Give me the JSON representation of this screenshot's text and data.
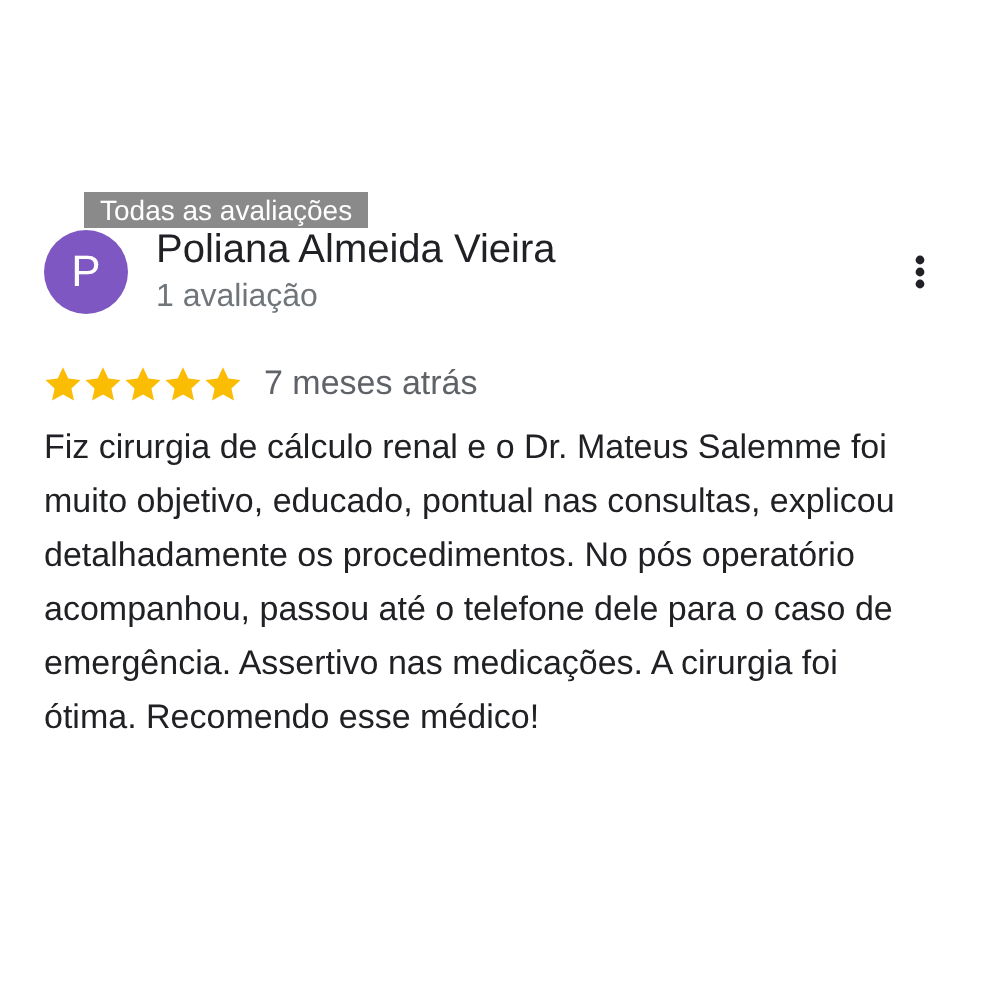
{
  "tooltip": {
    "text": "Todas as avaliações"
  },
  "review": {
    "avatar_letter": "P",
    "author": "Poliana Almeida Vieira",
    "author_meta": "1 avaliação",
    "stars": 5,
    "time": "7 meses atrás",
    "text": "Fiz cirurgia de cálculo renal e o Dr. Mateus Salemme foi muito objetivo, educado, pontual nas consultas, explicou detalhadamente os procedimentos. No pós operatório acompanhou, passou até o telefone dele para o caso de emergência. Assertivo nas medicações. A cirurgia foi ótima. Recomendo esse médico!"
  }
}
